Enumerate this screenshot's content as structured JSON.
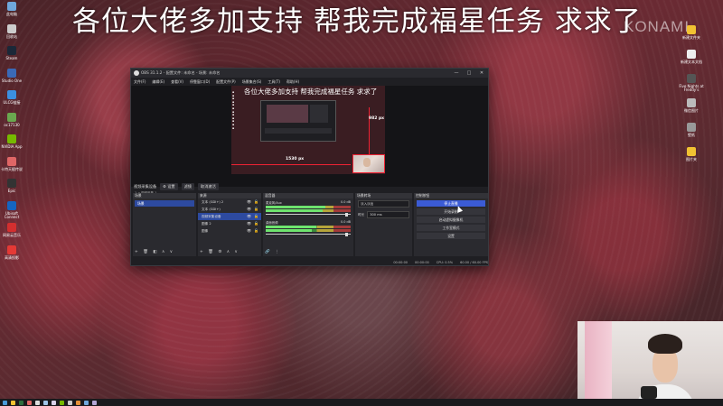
{
  "banner_text": "各位大佬多加支持 帮我完成福星任务 求求了",
  "watermark": "KONAMI",
  "desktop_icons_left": [
    {
      "label": "此电脑",
      "color": "#6fa8dc"
    },
    {
      "label": "回收站",
      "color": "#cccccc"
    },
    {
      "label": "Steam",
      "color": "#1b2838"
    },
    {
      "label": "Studio One",
      "color": "#3a6ab8"
    },
    {
      "label": "ULCG链接",
      "color": "#3b8fe0"
    },
    {
      "label": "oc17130",
      "color": "#6aa84f"
    },
    {
      "label": "NVIDIA App",
      "color": "#76b900"
    },
    {
      "label": "卡特天赋传说",
      "color": "#e06666"
    },
    {
      "label": "Epic",
      "color": "#333333"
    },
    {
      "label": "Ubisoft Connect",
      "color": "#1565c0"
    },
    {
      "label": "网易云音乐",
      "color": "#d32f2f"
    },
    {
      "label": "高清投影",
      "color": "#e53935"
    }
  ],
  "desktop_icons_right": [
    {
      "label": "新建文件夹",
      "color": "#f1c232"
    },
    {
      "label": "新建文本文档",
      "color": "#eeeeee"
    },
    {
      "label": "Five Nights at Freddy's",
      "color": "#555555"
    },
    {
      "label": "微信图片",
      "color": "#bbbbbb"
    },
    {
      "label": "壁纸",
      "color": "#999999"
    },
    {
      "label": "图片夹",
      "color": "#f1c232"
    }
  ],
  "obs": {
    "title": "OBS 31.1.2 - 配置文件: 未命名 - 场景: 未命名",
    "window_controls": [
      "—",
      "□",
      "✕"
    ],
    "menu": [
      "文件(F)",
      "编辑(E)",
      "查看(V)",
      "停靠窗口(D)",
      "配置文件(P)",
      "场景集合(S)",
      "工具(T)",
      "帮助(H)"
    ],
    "preview_text": "各位大佬多加支持 帮我完成福星任务 求求了",
    "dimension_1": "982 px",
    "dimension_2": "1530 px",
    "preview_bottom": "1 ∨  视频采集 1",
    "toolbar": {
      "source_name": "视频采集设备",
      "properties": "⚙ 设置",
      "filters": "滤镜",
      "deactivate": "取消激活"
    },
    "scenes": {
      "header": "场景",
      "items": [
        "场景"
      ]
    },
    "sources": {
      "header": "来源",
      "items": [
        {
          "label": "文本 (GDI+) 2",
          "selected": false
        },
        {
          "label": "文本 (GDI+)",
          "selected": false
        },
        {
          "label": "视频采集设备",
          "selected": true
        },
        {
          "label": "图像 2",
          "selected": false
        },
        {
          "label": "图像",
          "selected": false
        }
      ]
    },
    "mixer": {
      "header": "混音器",
      "channels": [
        {
          "name": "麦克风/Aux",
          "db": "0.0 dB",
          "level": 0.7
        },
        {
          "name": "桌面音频",
          "db": "0.0 dB",
          "level": 0.6
        }
      ]
    },
    "transitions": {
      "header": "场景转场",
      "type": "淡入淡出",
      "duration_label": "时长",
      "duration": "300 ms"
    },
    "controls": {
      "header": "控制按钮",
      "buttons": [
        "停止直播",
        "开始录制",
        "启动虚拟摄像机",
        "工作室模式",
        "设置"
      ]
    },
    "status": {
      "live": "00:00:00",
      "rec": "00:00:00",
      "cpu": "CPU: 0.5%",
      "fps": "60.00 / 60.00 FPS"
    }
  },
  "icons": {
    "gear": "gear-icon",
    "eye": "eye-icon",
    "lock": "lock-icon"
  }
}
